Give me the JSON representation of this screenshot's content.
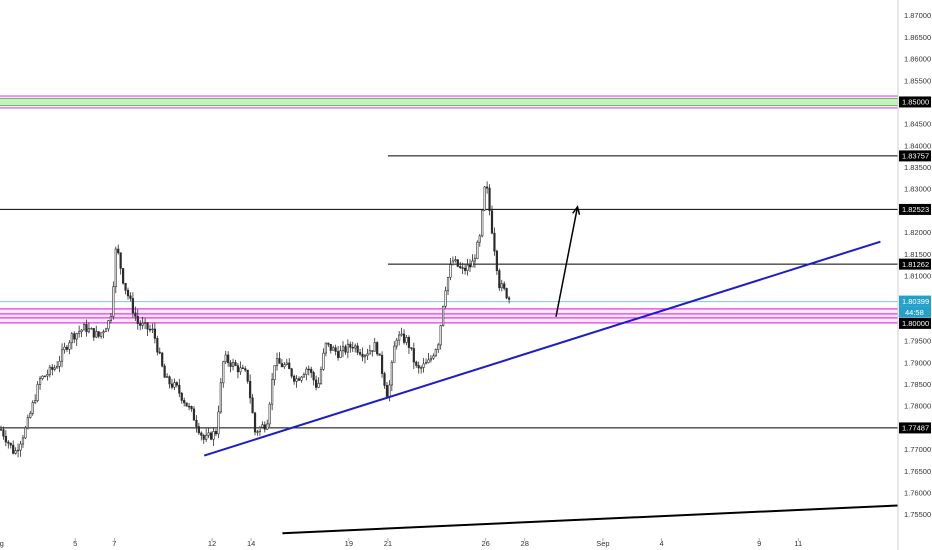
{
  "chart_data": {
    "type": "candlestick",
    "ylim": [
      1.7495,
      1.8735
    ],
    "y_ticks": [
      "1.87000",
      "1.86500",
      "1.86000",
      "1.85500",
      "1.84500",
      "1.84000",
      "1.83500",
      "1.83000",
      "1.82000",
      "1.81500",
      "1.81000",
      "1.79500",
      "1.79000",
      "1.78500",
      "1.78000",
      "1.77000",
      "1.76500",
      "1.76000",
      "1.75500"
    ],
    "x_ticks": [
      {
        "label": "Aug",
        "d": 0
      },
      {
        "label": "5",
        "d": 4
      },
      {
        "label": "7",
        "d": 6
      },
      {
        "label": "12",
        "d": 11
      },
      {
        "label": "14",
        "d": 13
      },
      {
        "label": "19",
        "d": 18
      },
      {
        "label": "21",
        "d": 20
      },
      {
        "label": "26",
        "d": 25
      },
      {
        "label": "28",
        "d": 27
      },
      {
        "label": "Sep",
        "d": 31
      },
      {
        "label": "4",
        "d": 34
      },
      {
        "label": "9",
        "d": 39
      },
      {
        "label": "11",
        "d": 41
      }
    ],
    "x_range_days": [
      0.15,
      46.1
    ],
    "price_waypoints": [
      [
        0.2,
        1.7745
      ],
      [
        0.9,
        1.769
      ],
      [
        1.5,
        1.775
      ],
      [
        2.2,
        1.786
      ],
      [
        3.0,
        1.789
      ],
      [
        3.8,
        1.796
      ],
      [
        4.5,
        1.798
      ],
      [
        5.2,
        1.796
      ],
      [
        5.8,
        1.8
      ],
      [
        6.1,
        1.817
      ],
      [
        6.5,
        1.808
      ],
      [
        7.2,
        1.799
      ],
      [
        8.0,
        1.797
      ],
      [
        8.6,
        1.786
      ],
      [
        9.2,
        1.784
      ],
      [
        10.0,
        1.778
      ],
      [
        10.6,
        1.772
      ],
      [
        11.2,
        1.774
      ],
      [
        11.6,
        1.791
      ],
      [
        12.2,
        1.789
      ],
      [
        12.8,
        1.787
      ],
      [
        13.2,
        1.774
      ],
      [
        13.8,
        1.776
      ],
      [
        14.2,
        1.79
      ],
      [
        14.8,
        1.789
      ],
      [
        15.3,
        1.786
      ],
      [
        15.9,
        1.789
      ],
      [
        16.4,
        1.784
      ],
      [
        16.8,
        1.794
      ],
      [
        17.5,
        1.792
      ],
      [
        18.2,
        1.794
      ],
      [
        18.8,
        1.792
      ],
      [
        19.4,
        1.794
      ],
      [
        20.0,
        1.782
      ],
      [
        20.4,
        1.796
      ],
      [
        21.0,
        1.795
      ],
      [
        21.5,
        1.788
      ],
      [
        22.1,
        1.79
      ],
      [
        22.6,
        1.795
      ],
      [
        22.9,
        1.8065
      ],
      [
        23.3,
        1.8135
      ],
      [
        23.8,
        1.811
      ],
      [
        24.3,
        1.8125
      ],
      [
        24.7,
        1.8185
      ],
      [
        25.0,
        1.832
      ],
      [
        25.3,
        1.8215
      ],
      [
        25.7,
        1.808
      ],
      [
        26.1,
        1.8055
      ],
      [
        26.3,
        1.804
      ]
    ],
    "horizontal_levels": [
      {
        "price": 1.85,
        "label": "1.85000",
        "style": "green-zone"
      },
      {
        "price": 1.83757,
        "label": "1.83757",
        "style": "line",
        "from_d": 20.0
      },
      {
        "price": 1.82523,
        "label": "1.82523",
        "style": "line",
        "from_d": 0.15
      },
      {
        "price": 1.81262,
        "label": "1.81262",
        "style": "line",
        "from_d": 20.0
      },
      {
        "price": 1.80399,
        "label": "1.80399",
        "style": "current"
      },
      {
        "price": 1.8,
        "label": "1.80000",
        "style": "magenta-zone"
      },
      {
        "price": 1.77487,
        "label": "1.77487",
        "style": "line",
        "from_d": 0.15
      }
    ],
    "countdown": "44:58",
    "trendlines": [
      {
        "name": "blue-support",
        "color": "#1c1ccc",
        "p1": [
          10.6,
          1.7685
        ],
        "p2": [
          45.2,
          1.8178
        ]
      },
      {
        "name": "lower-trendline",
        "color": "#000000",
        "p1": [
          14.6,
          1.7506
        ],
        "p2": [
          46.1,
          1.757
        ]
      }
    ],
    "projection_arrow": {
      "from": [
        28.6,
        1.8005
      ],
      "to": [
        29.7,
        1.8258
      ]
    },
    "colors": {
      "candle": "#2a2a2a",
      "candle_up_body": "#ffffff",
      "blue_line": "#1c1ccc",
      "magenta": "#e040e0",
      "green_fill": "#c6f0c0",
      "zone_fill": "#fde8fd",
      "current_price": "#7ec8e3",
      "label_bg": "#000000"
    }
  }
}
